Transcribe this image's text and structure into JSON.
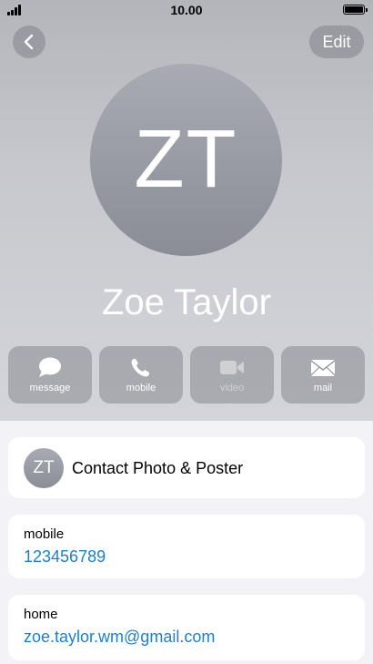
{
  "status_bar": {
    "time": "10.00"
  },
  "nav": {
    "back_icon": "chevron-left-icon",
    "edit_label": "Edit"
  },
  "contact": {
    "initials": "ZT",
    "name": "Zoe Taylor"
  },
  "actions": [
    {
      "label": "message",
      "icon": "message-bubble-icon",
      "enabled": true
    },
    {
      "label": "mobile",
      "icon": "phone-icon",
      "enabled": true
    },
    {
      "label": "video",
      "icon": "video-camera-icon",
      "enabled": false
    },
    {
      "label": "mail",
      "icon": "envelope-icon",
      "enabled": true
    }
  ],
  "photo_card": {
    "initials": "ZT",
    "label": "Contact Photo & Poster"
  },
  "fields": [
    {
      "label": "mobile",
      "value": "123456789"
    },
    {
      "label": "home",
      "value": "zoe.taylor.wm@gmail.com"
    }
  ],
  "colors": {
    "link": "#1a7fd6",
    "header_bg": "#c7c8cd",
    "page_bg": "#f2f2f7"
  }
}
